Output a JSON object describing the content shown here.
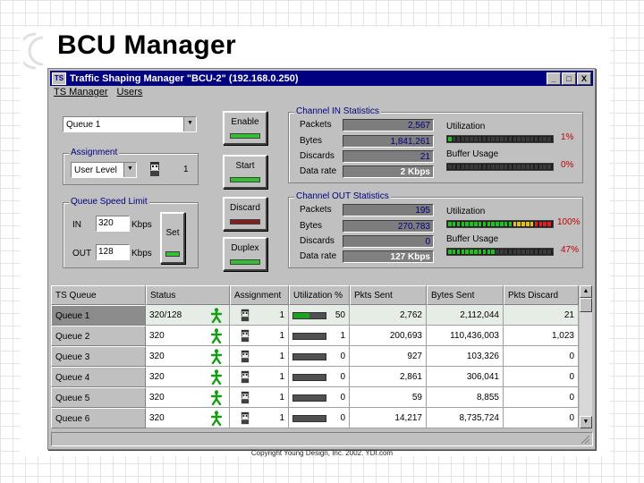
{
  "slide": {
    "title": "BCU Manager"
  },
  "window": {
    "title": "Traffic Shaping Manager \"BCU-2\" (192.168.0.250)",
    "app_icon": "tsm-app-icon",
    "buttons": {
      "minimize": "_",
      "maximize": "□",
      "close": "X"
    }
  },
  "menu": {
    "items": [
      "TS Manager",
      "Users"
    ]
  },
  "queue_select": {
    "value": "Queue 1"
  },
  "assignment": {
    "legend": "Assignment",
    "value": "User Level",
    "count": "1",
    "icon": "user-face-icon"
  },
  "speed_limit": {
    "legend": "Queue Speed Limit",
    "in_label": "IN",
    "in_value": "320",
    "out_label": "OUT",
    "out_value": "128",
    "unit": "Kbps",
    "set_label": "Set"
  },
  "actions": [
    {
      "label": "Enable",
      "led": "#30c030"
    },
    {
      "label": "Start",
      "led": "#30c030"
    },
    {
      "label": "Discard",
      "led": "#802020"
    },
    {
      "label": "Duplex",
      "led": "#30c030"
    }
  ],
  "channel_in": {
    "legend": "Channel IN Statistics",
    "rows": [
      {
        "label": "Packets",
        "value": "2,567"
      },
      {
        "label": "Bytes",
        "value": "1,841,261"
      },
      {
        "label": "Discards",
        "value": "21"
      },
      {
        "label": "Data rate",
        "value": "2 Kbps"
      }
    ],
    "utilization_label": "Utilization",
    "utilization_pct": "1%",
    "utilization_level": 0.01,
    "buffer_label": "Buffer Usage",
    "buffer_pct": "0%",
    "buffer_level": 0.0
  },
  "channel_out": {
    "legend": "Channel OUT Statistics",
    "rows": [
      {
        "label": "Packets",
        "value": "195"
      },
      {
        "label": "Bytes",
        "value": "270,783"
      },
      {
        "label": "Discards",
        "value": "0"
      },
      {
        "label": "Data rate",
        "value": "127 Kbps"
      }
    ],
    "utilization_label": "Utilization",
    "utilization_pct": "100%",
    "utilization_level": 1.0,
    "buffer_label": "Buffer Usage",
    "buffer_pct": "47%",
    "buffer_level": 0.47
  },
  "table": {
    "columns": [
      "TS Queue",
      "Status",
      "Assignment",
      "Utilization %",
      "Pkts Sent",
      "Bytes Sent",
      "Pkts Discard"
    ],
    "rows": [
      {
        "name": "Queue 1",
        "status": "320/128",
        "assign": "1",
        "util": "50",
        "util_level": 0.5,
        "pkts": "2,762",
        "bytes": "2,112,044",
        "discard": "21"
      },
      {
        "name": "Queue 2",
        "status": "320",
        "assign": "1",
        "util": "1",
        "util_level": 0.01,
        "pkts": "200,693",
        "bytes": "110,436,003",
        "discard": "1,023"
      },
      {
        "name": "Queue 3",
        "status": "320",
        "assign": "1",
        "util": "0",
        "util_level": 0.0,
        "pkts": "927",
        "bytes": "103,326",
        "discard": "0"
      },
      {
        "name": "Queue 4",
        "status": "320",
        "assign": "1",
        "util": "0",
        "util_level": 0.0,
        "pkts": "2,861",
        "bytes": "306,041",
        "discard": "0"
      },
      {
        "name": "Queue 5",
        "status": "320",
        "assign": "1",
        "util": "0",
        "util_level": 0.0,
        "pkts": "59",
        "bytes": "8,855",
        "discard": "0"
      },
      {
        "name": "Queue 6",
        "status": "320",
        "assign": "1",
        "util": "0",
        "util_level": 0.0,
        "pkts": "14,217",
        "bytes": "8,735,724",
        "discard": "0"
      }
    ]
  },
  "footer": {
    "copyright": "Copyright Young Design, Inc. 2002. YDI.com"
  },
  "colors": {
    "titlebar": "#000080",
    "face": "#c0c0c0",
    "ok_green": "#20a020",
    "alert_red": "#c00000"
  }
}
